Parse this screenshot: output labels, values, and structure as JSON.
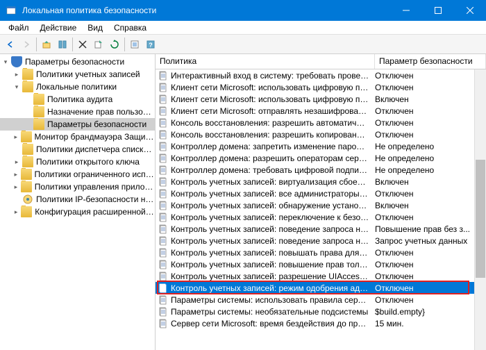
{
  "window": {
    "title": "Локальная политика безопасности"
  },
  "menu": {
    "file": "Файл",
    "action": "Действие",
    "view": "Вид",
    "help": "Справка"
  },
  "tree": {
    "root": "Параметры безопасности",
    "account_policies": "Политики учетных записей",
    "local_policies": "Локальные политики",
    "audit_policy": "Политика аудита",
    "user_rights": "Назначение прав пользователя",
    "security_options": "Параметры безопасности",
    "firewall": "Монитор брандмауэра Защитника W",
    "network_list": "Политики диспетчера списка сетей",
    "public_key": "Политики открытого ключа",
    "restricted": "Политики ограниченного использова",
    "app_control": "Политики управления приложением",
    "ip_security": "Политики IP-безопасности на \"Лок",
    "advanced_audit": "Конфигурация расширенной полит"
  },
  "columns": {
    "policy": "Политика",
    "setting": "Параметр безопасности"
  },
  "policies": [
    {
      "name": "Интерактивный вход в систему: требовать проверки н...",
      "value": "Отключен"
    },
    {
      "name": "Клиент сети Microsoft: использовать цифровую подпис...",
      "value": "Отключен"
    },
    {
      "name": "Клиент сети Microsoft: использовать цифровую подпис...",
      "value": "Включен"
    },
    {
      "name": "Клиент сети Microsoft: отправлять незашифрованный ...",
      "value": "Отключен"
    },
    {
      "name": "Консоль восстановления: разрешить автоматический вх...",
      "value": "Отключен"
    },
    {
      "name": "Консоль восстановления: разрешить копирование диск...",
      "value": "Отключен"
    },
    {
      "name": "Контроллер домена: запретить изменение пароля учетн...",
      "value": "Не определено"
    },
    {
      "name": "Контроллер домена: разрешить операторам сервера зад...",
      "value": "Не определено"
    },
    {
      "name": "Контроллер домена: требовать цифровой подписи для ...",
      "value": "Не определено"
    },
    {
      "name": "Контроль учетных записей: виртуализация сбоев записи...",
      "value": "Включен"
    },
    {
      "name": "Контроль учетных записей: все администраторы работа...",
      "value": "Отключен"
    },
    {
      "name": "Контроль учетных записей: обнаружение установки при...",
      "value": "Включен"
    },
    {
      "name": "Контроль учетных записей: переключение к безопасно...",
      "value": "Отключен"
    },
    {
      "name": "Контроль учетных записей: поведение запроса на повы...",
      "value": "Повышение прав без з..."
    },
    {
      "name": "Контроль учетных записей: поведение запроса на повы...",
      "value": "Запрос учетных данных"
    },
    {
      "name": "Контроль учетных записей: повышать права для UIAcc...",
      "value": "Отключен"
    },
    {
      "name": "Контроль учетных записей: повышение прав только для ...",
      "value": "Отключен"
    },
    {
      "name": "Контроль учетных записей: разрешение UIAccess-прило...",
      "value": "Отключен"
    },
    {
      "name": "Контроль учетных записей: режим одобрения админист...",
      "value": "Отключен"
    },
    {
      "name": "Параметры системы: использовать правила сертификат...",
      "value": "Отключен"
    },
    {
      "name": "Параметры системы: необязательные подсистемы",
      "value": "$build.empty}"
    },
    {
      "name": "Сервер сети Microsoft: время бездействия до приостанов...",
      "value": "15 мин."
    }
  ]
}
